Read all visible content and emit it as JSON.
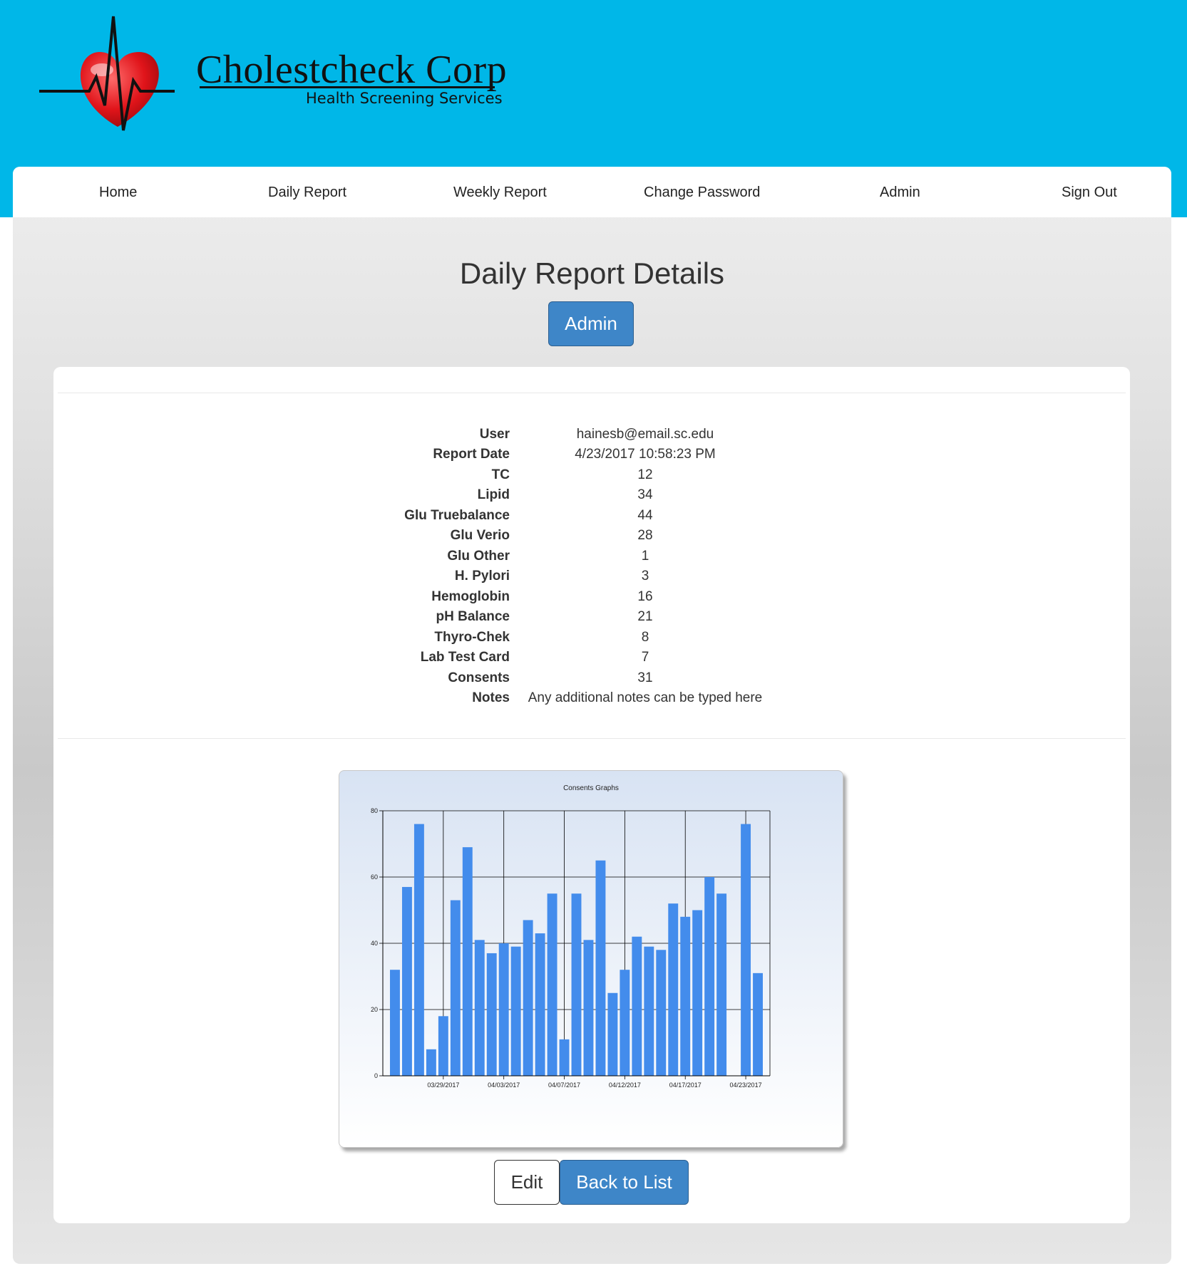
{
  "brand": {
    "name": "Cholestcheck Corp",
    "tagline": "Health Screening Services"
  },
  "nav": {
    "items": [
      "Home",
      "Daily Report",
      "Weekly Report",
      "Change Password",
      "Admin",
      "Sign Out"
    ]
  },
  "page": {
    "title": "Daily Report Details",
    "admin_button": "Admin"
  },
  "details": [
    {
      "label": "User",
      "value": "hainesb@email.sc.edu"
    },
    {
      "label": "Report Date",
      "value": "4/23/2017 10:58:23 PM"
    },
    {
      "label": "TC",
      "value": "12"
    },
    {
      "label": "Lipid",
      "value": "34"
    },
    {
      "label": "Glu Truebalance",
      "value": "44"
    },
    {
      "label": "Glu Verio",
      "value": "28"
    },
    {
      "label": "Glu Other",
      "value": "1"
    },
    {
      "label": "H. Pylori",
      "value": "3"
    },
    {
      "label": "Hemoglobin",
      "value": "16"
    },
    {
      "label": "pH Balance",
      "value": "21"
    },
    {
      "label": "Thyro-Chek",
      "value": "8"
    },
    {
      "label": "Lab Test Card",
      "value": "7"
    },
    {
      "label": "Consents",
      "value": "31"
    },
    {
      "label": "Notes",
      "value": "Any additional notes can be typed here"
    }
  ],
  "actions": {
    "edit": "Edit",
    "back": "Back to List"
  },
  "colors": {
    "header_bg": "#00b7e8",
    "primary_button": "#3e86c8",
    "bar": "#438cec"
  },
  "chart_data": {
    "type": "bar",
    "title": "Consents Graphs",
    "xlabel": "",
    "ylabel": "",
    "ylim": [
      0,
      80
    ],
    "yticks": [
      0,
      20,
      40,
      60,
      80
    ],
    "xtick_labels": [
      "03/29/2017",
      "04/03/2017",
      "04/07/2017",
      "04/12/2017",
      "04/17/2017",
      "04/23/2017"
    ],
    "grid": true,
    "values": [
      32,
      57,
      76,
      8,
      18,
      53,
      69,
      41,
      37,
      40,
      39,
      47,
      43,
      55,
      11,
      55,
      41,
      65,
      25,
      32,
      42,
      39,
      38,
      52,
      48,
      50,
      60,
      55,
      null,
      76,
      31
    ]
  }
}
